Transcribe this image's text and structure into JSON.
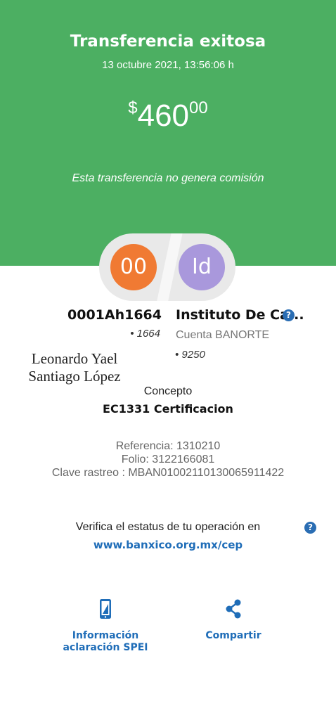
{
  "header": {
    "title": "Transferencia exitosa",
    "datetime": "13 octubre 2021, 13:56:06 h",
    "amount": {
      "currency": "$",
      "integer": "460",
      "decimals": "00"
    },
    "commission_note": "Esta transferencia no genera comisión",
    "color": "#4caf62"
  },
  "sender": {
    "initials": "00",
    "name": "0001Ah1664",
    "account": "1664",
    "avatar_color": "#f07a33"
  },
  "receiver": {
    "initials": "Id",
    "name": "Instituto De Ca...",
    "bank": "Cuenta BANORTE",
    "account": "9250",
    "avatar_color": "#a998dc"
  },
  "signature": {
    "line1": "Leonardo Yael",
    "line2": "Santiago López"
  },
  "concept": {
    "label": "Concepto",
    "value": "EC1331 Certificacion"
  },
  "references": {
    "referencia": "Referencia: 1310210",
    "folio": "Folio: 3122166081",
    "clave": "Clave rastreo : MBAN01002110130065911422"
  },
  "verify": {
    "text": "Verifica el estatus de tu operación en",
    "link": "www.banxico.org.mx/cep"
  },
  "actions": {
    "info": {
      "line1": "Información",
      "line2": "aclaración SPEI",
      "icon": "phone-info-icon"
    },
    "share": {
      "label": "Compartir",
      "icon": "share-icon"
    }
  },
  "help_symbol": "?",
  "accent_color": "#1f6db8"
}
